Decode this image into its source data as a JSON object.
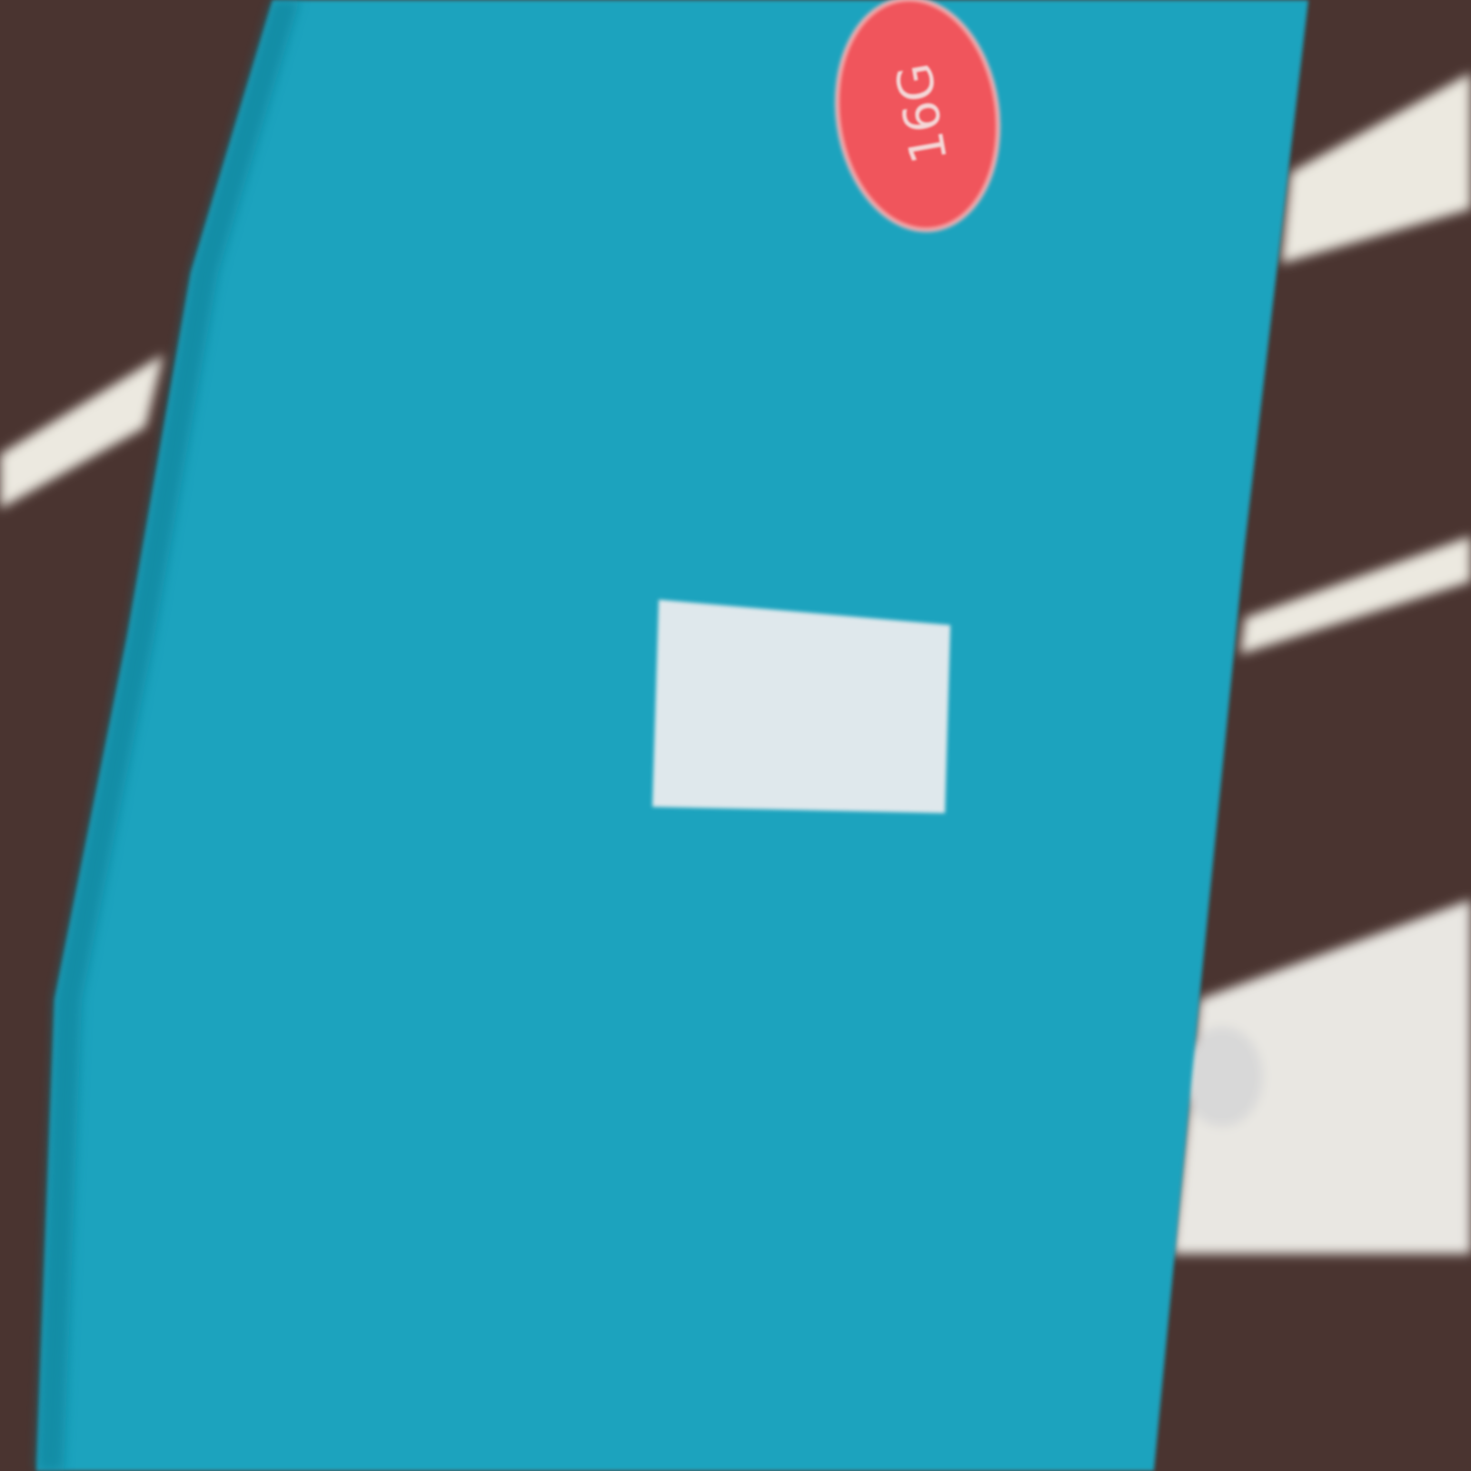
{
  "photo": {
    "object_color": "#1aa3be",
    "sticker": {
      "text": "16G",
      "color": "#f0545c"
    },
    "label_color": "#dfe8ec",
    "background_colors": {
      "hand": "#4a3430",
      "surface": "#ece9e0"
    }
  }
}
